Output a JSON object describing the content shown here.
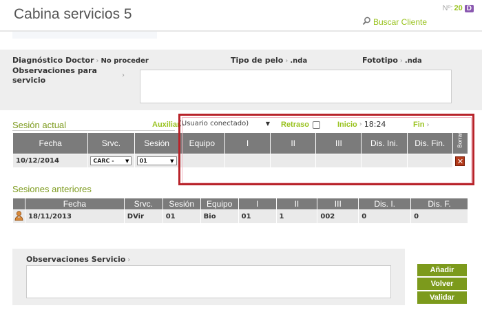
{
  "header": {
    "title": "Cabina servicios 5",
    "counter_label": "Nº:",
    "counter_value": "20",
    "counter_badge": "D",
    "search_link": "Buscar Cliente"
  },
  "info": {
    "diagnostico_label": "Diagnóstico Doctor",
    "diagnostico_value": "No proceder",
    "tipo_pelo_label": "Tipo de pelo",
    "tipo_pelo_value": ".nda",
    "fototipo_label": "Fototipo",
    "fototipo_value": ".nda",
    "observaciones_label_1": "Observaciones para",
    "observaciones_label_2": "servicio",
    "observaciones_value": ""
  },
  "sesion_actual": {
    "title": "Sesión actual",
    "auxiliar_label": "Auxiliar",
    "auxiliar_selected": "(Usuario conectado)",
    "retraso_label": "Retraso",
    "inicio_label": "Inicio",
    "inicio_time": "18:24",
    "fin_label": "Fin",
    "columns": [
      "Fecha",
      "Srvc.",
      "Sesión",
      "Equipo",
      "I",
      "II",
      "III",
      "Dis. Ini.",
      "Dis. Fin.",
      "Borrar"
    ],
    "row": {
      "fecha": "10/12/2014",
      "srvc": "CARC -",
      "sesion": "01"
    }
  },
  "sesiones_anteriores": {
    "title": "Sesiones anteriores",
    "columns": [
      "Fecha",
      "Srvc.",
      "Sesión",
      "Equipo",
      "I",
      "II",
      "III",
      "Dis. I.",
      "Dis. F."
    ],
    "rows": [
      {
        "fecha": "18/11/2013",
        "srvc": "DVir",
        "sesion": "01",
        "equipo": "Bio",
        "i": "01",
        "ii": "1",
        "iii": "002",
        "dis_i": "0",
        "dis_f": "0"
      }
    ]
  },
  "observaciones_servicio": {
    "label": "Observaciones Servicio",
    "value": ""
  },
  "buttons": {
    "anadir": "Añadir",
    "volver": "Volver",
    "validar": "Validar"
  },
  "colors": {
    "accent_green": "#98c21d",
    "button_green": "#7c9a1c",
    "header_gray": "#7b7b7b",
    "highlight_red": "#b8232a",
    "badge_purple": "#8a58b0"
  }
}
